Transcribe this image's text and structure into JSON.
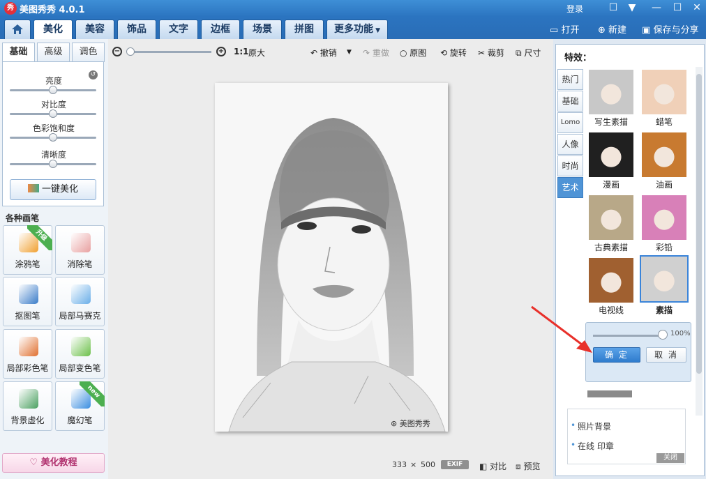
{
  "titlebar": {
    "logo": "秀",
    "title": "美图秀秀 4.0.1",
    "login": "登录",
    "controls": {
      "message": "☐",
      "menu": "▼",
      "minimize": "—",
      "maximize": "☐",
      "close": "✕"
    }
  },
  "main_tabs": [
    {
      "label": "美化",
      "active": true
    },
    {
      "label": "美容",
      "active": false
    },
    {
      "label": "饰品",
      "active": false
    },
    {
      "label": "文字",
      "active": false
    },
    {
      "label": "边框",
      "active": false
    },
    {
      "label": "场景",
      "active": false
    },
    {
      "label": "拼图",
      "active": false
    },
    {
      "label": "更多功能",
      "active": false
    }
  ],
  "top_actions": {
    "open": "打开",
    "new": "新建",
    "save_share": "保存与分享"
  },
  "left": {
    "subtabs": [
      {
        "label": "基础",
        "active": true
      },
      {
        "label": "高级",
        "active": false
      },
      {
        "label": "调色",
        "active": false
      }
    ],
    "sliders": [
      {
        "label": "亮度",
        "value": 0.5
      },
      {
        "label": "对比度",
        "value": 0.5
      },
      {
        "label": "色彩饱和度",
        "value": 0.5
      },
      {
        "label": "清晰度",
        "value": 0.5
      }
    ],
    "one_click": "一键美化",
    "brushes_title": "各种画笔",
    "brushes": [
      {
        "label": "涂鸦笔",
        "badge": "升级",
        "icon": "pen-brush-icon",
        "color": "#f0a030"
      },
      {
        "label": "消除笔",
        "badge": "",
        "icon": "eraser-icon",
        "color": "#e8a0a0"
      },
      {
        "label": "抠图笔",
        "badge": "",
        "icon": "cutout-pen-icon",
        "color": "#3a7cc8"
      },
      {
        "label": "局部马赛克",
        "badge": "",
        "icon": "mosaic-icon",
        "color": "#6aaee8"
      },
      {
        "label": "局部彩色笔",
        "badge": "",
        "icon": "color-brush-icon",
        "color": "#e07030"
      },
      {
        "label": "局部变色笔",
        "badge": "",
        "icon": "paint-bucket-icon",
        "color": "#6cc04a"
      },
      {
        "label": "背景虚化",
        "badge": "",
        "icon": "blur-bg-icon",
        "color": "#4aa060"
      },
      {
        "label": "魔幻笔",
        "badge": "new",
        "icon": "magic-pen-icon",
        "color": "#3a8ee0"
      }
    ],
    "tutorial": "美化教程"
  },
  "toolbar": {
    "zoom_ratio": "1:1",
    "original_size": "原大",
    "undo": "撤销",
    "redo": "重做",
    "original": "原图",
    "rotate": "旋转",
    "crop": "裁剪",
    "resize": "尺寸"
  },
  "canvas": {
    "watermark": "美图秀秀",
    "width": "333",
    "times": "×",
    "height": "500",
    "exif": "EXIF",
    "compare": "对比",
    "preview": "预览"
  },
  "right": {
    "title": "特效：",
    "categories": [
      {
        "label": "热门",
        "active": false
      },
      {
        "label": "基础",
        "active": false
      },
      {
        "label": "Lomo",
        "active": false
      },
      {
        "label": "人像",
        "active": false
      },
      {
        "label": "时尚",
        "active": false
      },
      {
        "label": "艺术",
        "active": true
      }
    ],
    "effects": [
      {
        "label": "写生素描",
        "selected": false,
        "tone": "#c8c8c8"
      },
      {
        "label": "蜡笔",
        "selected": false,
        "tone": "#f0d0b8"
      },
      {
        "label": "漫画",
        "selected": false,
        "tone": "#202020"
      },
      {
        "label": "油画",
        "selected": false,
        "tone": "#c87a30"
      },
      {
        "label": "古典素描",
        "selected": false,
        "tone": "#b8a888"
      },
      {
        "label": "彩铅",
        "selected": false,
        "tone": "#d880b8"
      },
      {
        "label": "电视线",
        "selected": false,
        "tone": "#a06030"
      },
      {
        "label": "素描",
        "selected": true,
        "tone": "#d0d0d0"
      }
    ],
    "opacity": "100%",
    "opacity_value": 1.0,
    "confirm": "确 定",
    "cancel": "取 消",
    "ads": [
      "照片背景",
      "在线 印章"
    ],
    "ad_close": "关闭"
  }
}
